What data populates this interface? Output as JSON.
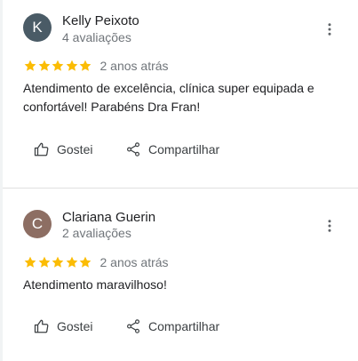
{
  "colors": {
    "star": "#fbbc04",
    "avatar_k": "#4a5b66",
    "avatar_c": "#8d6e63"
  },
  "reviews": [
    {
      "avatar_letter": "K",
      "name": "Kelly Peixoto",
      "review_count": "4 avaliações",
      "rating": 5,
      "date": "2 anos atrás",
      "text": "Atendimento de excelência, clínica super equipada e confortável! Parabéns Dra Fran!",
      "like_label": "Gostei",
      "share_label": "Compartilhar",
      "menu_icon": "more-vert-icon"
    },
    {
      "avatar_letter": "C",
      "name": "Clariana Guerin",
      "review_count": "2 avaliações",
      "rating": 5,
      "date": "2 anos atrás",
      "text": "Atendimento maravilhoso!",
      "like_label": "Gostei",
      "share_label": "Compartilhar",
      "menu_icon": "more-vert-icon"
    }
  ]
}
